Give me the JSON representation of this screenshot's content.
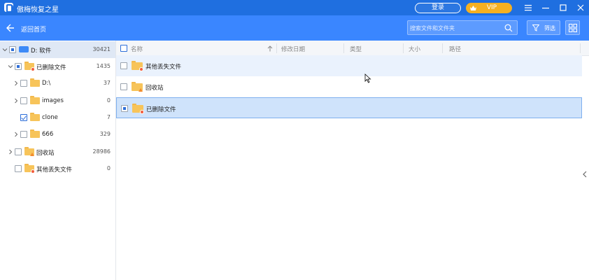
{
  "app": {
    "title": "傲梅恢复之星",
    "login_label": "登录",
    "vip_label": "VIP"
  },
  "header": {
    "back_label": "返回首页",
    "search_placeholder": "搜索文件和文件夹",
    "filter_label": "筛选"
  },
  "sidebar": {
    "items": [
      {
        "label": "D: 软件",
        "count": "30421",
        "icon": "drive-icon",
        "state": "partial",
        "expanded": true,
        "selected": true
      },
      {
        "label": "已删除文件",
        "count": "1435",
        "icon": "deleted-folder-icon",
        "state": "partial",
        "expanded": true
      },
      {
        "label": "D:\\",
        "count": "37",
        "icon": "folder-icon",
        "state": "unchecked"
      },
      {
        "label": "images",
        "count": "0",
        "icon": "folder-icon",
        "state": "unchecked"
      },
      {
        "label": "clone",
        "count": "7",
        "icon": "folder-icon",
        "state": "checked"
      },
      {
        "label": "666",
        "count": "329",
        "icon": "folder-icon",
        "state": "unchecked"
      },
      {
        "label": "回收站",
        "count": "28986",
        "icon": "recycle-folder-icon",
        "state": "unchecked"
      },
      {
        "label": "其他丢失文件",
        "count": "0",
        "icon": "lost-folder-icon",
        "state": "unchecked"
      }
    ]
  },
  "table": {
    "columns": [
      "名称",
      "修改日期",
      "类型",
      "大小",
      "路径"
    ],
    "rows": [
      {
        "name": "其他丢失文件",
        "icon": "lost-folder-icon",
        "state": "hover"
      },
      {
        "name": "回收站",
        "icon": "recycle-folder-icon",
        "state": "normal"
      },
      {
        "name": "已删除文件",
        "icon": "deleted-folder-icon",
        "state": "selected"
      }
    ]
  },
  "colors": {
    "titlebar": "#1f6fe0",
    "headerbar": "#3a86ff",
    "vip": "#f5b021",
    "folder": "#f7c45a",
    "selected_row": "#cfe3fb"
  }
}
